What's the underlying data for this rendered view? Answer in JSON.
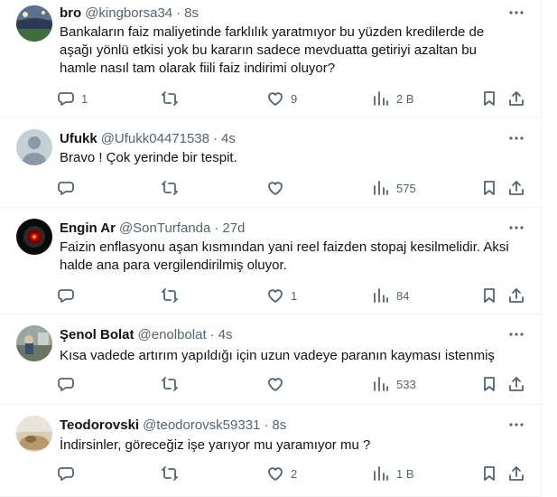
{
  "tweets": [
    {
      "name": "bro",
      "handle": "@kingborsa34",
      "time": "8s",
      "text": "Bankaların faiz maliyetinde farklılık yaratmıyor bu yüzden kredilerde de aşağı yönlü etkisi yok bu kararın sadece mevduatta getiriyi azaltan bu hamle nasıl tam olarak fiili faiz indirimi oluyor?",
      "replies": "1",
      "retweets": "",
      "likes": "9",
      "views": "2 B",
      "avatar": "stadium-photo"
    },
    {
      "name": "Ufukk",
      "handle": "@Ufukk04471538",
      "time": "4s",
      "text": "Bravo ! Çok yerinde bir tespit.",
      "replies": "",
      "retweets": "",
      "likes": "",
      "views": "575",
      "avatar": "default-person"
    },
    {
      "name": "Engin Ar",
      "handle": "@SonTurfanda",
      "time": "27d",
      "text": "Faizin enflasyonu aşan kısmından yani reel faizden stopaj kesilmelidir. Aksi halde ana para vergilendirilmiş oluyor.",
      "replies": "",
      "retweets": "",
      "likes": "1",
      "views": "84",
      "avatar": "hal9000-eye"
    },
    {
      "name": "Şenol Bolat",
      "handle": "@enolbolat",
      "time": "4s",
      "text": "Kısa vadede artırım yapıldığı için uzun vadeye paranın kayması istenmiş",
      "replies": "",
      "retweets": "",
      "likes": "",
      "views": "533",
      "avatar": "outdoor-photo"
    },
    {
      "name": "Teodorovski",
      "handle": "@teodorovsk59331",
      "time": "8s",
      "text": "İndirsinler, göreceğiz işe yarıyor mu yaramıyor mu ?",
      "replies": "",
      "retweets": "",
      "likes": "2",
      "views": "1 B",
      "avatar": "desert-photo"
    }
  ],
  "colors": {
    "text": "#0f1419",
    "muted": "#536471",
    "border": "#eff3f4"
  },
  "icons": [
    "more-icon",
    "reply-icon",
    "retweet-icon",
    "like-icon",
    "views-icon",
    "bookmark-icon",
    "share-icon"
  ]
}
